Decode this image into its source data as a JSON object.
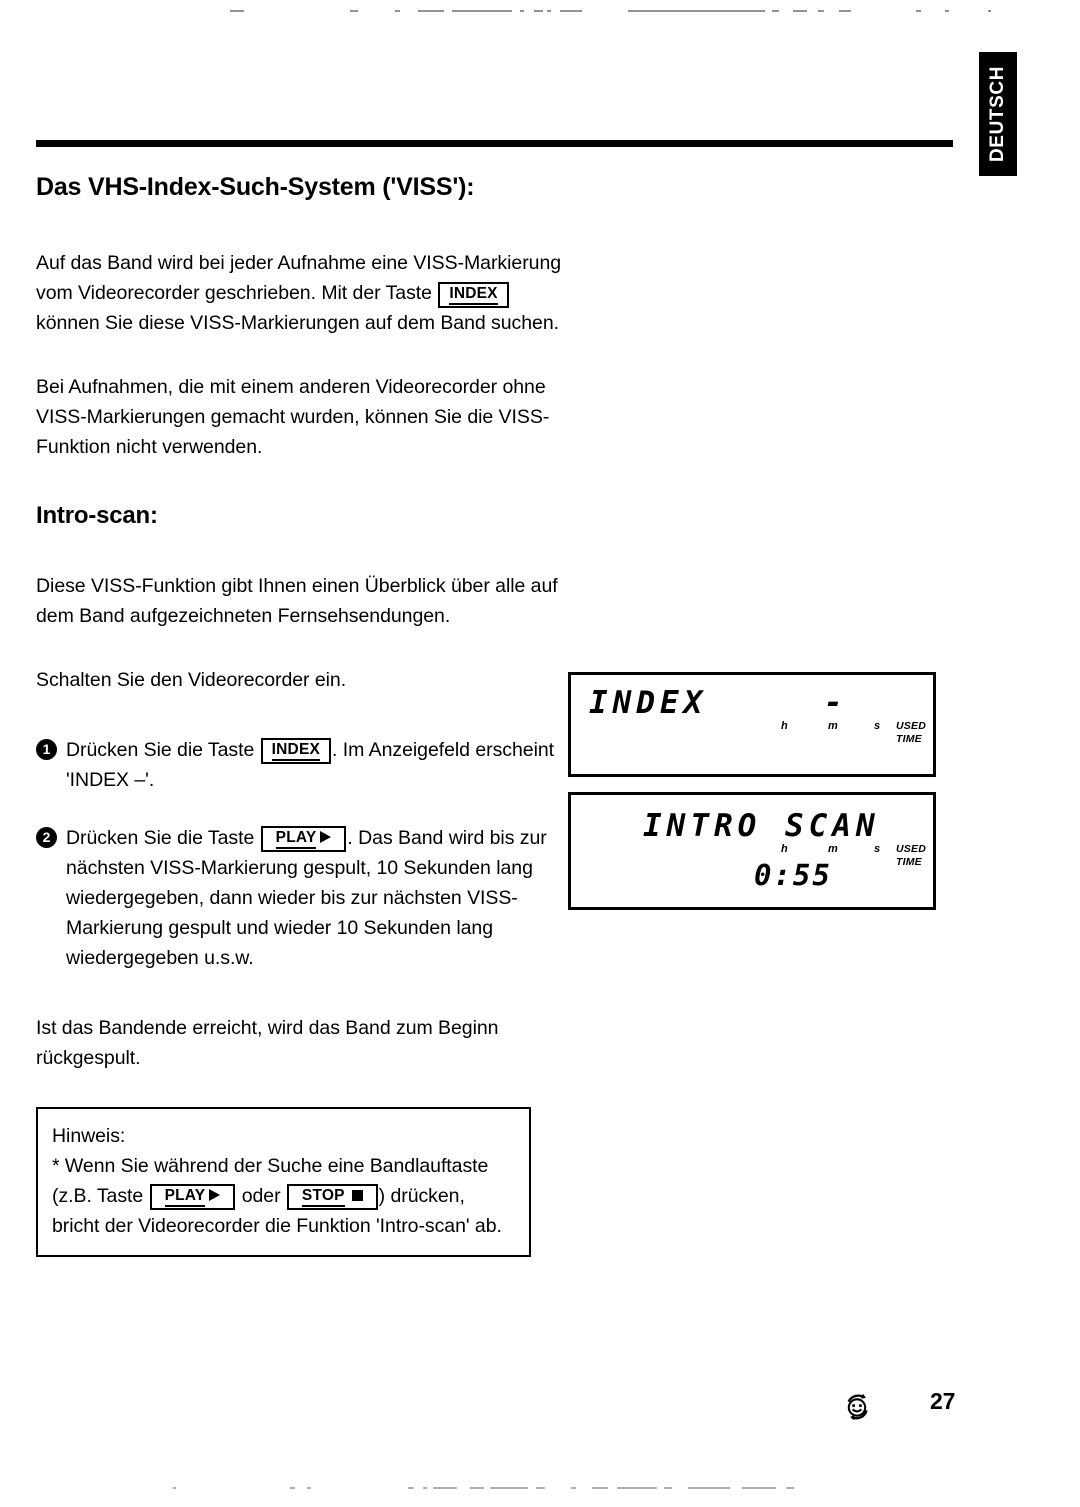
{
  "language_tab": {
    "label": "DEUTSCH"
  },
  "headings": {
    "section_title": "Das VHS-Index-Such-System ('VISS'):",
    "sub_title": "Intro-scan:"
  },
  "paragraphs": {
    "p1_a": "Auf das Band wird bei jeder Aufnahme eine VISS-Markierung vom Videorecorder geschrieben. Mit der Taste",
    "p1_b": "können Sie diese VISS-Markierungen auf dem Band suchen.",
    "p2": "Bei Aufnahmen, die mit einem anderen Videorecorder ohne VISS-Markierungen gemacht wurden, können Sie die VISS-Funktion nicht verwenden.",
    "p3": "Diese VISS-Funktion gibt Ihnen einen Überblick über alle auf dem Band aufgezeichneten Fernsehsendungen.",
    "p4": "Schalten Sie den Videorecorder ein.",
    "p5": "Ist das Bandende erreicht, wird das Band zum Beginn rückgespult."
  },
  "keys": {
    "index": "INDEX",
    "play": "PLAY",
    "stop": "STOP"
  },
  "steps": [
    {
      "number": "1",
      "text_before_key": "Drücken Sie die Taste",
      "text_after_key": ". Im Anzeigefeld erscheint 'INDEX –'."
    },
    {
      "number": "2",
      "text_before_key": "Drücken Sie die Taste",
      "text_after_key": ". Das Band wird bis zur nächsten VISS-Markierung gespult, 10 Sekunden lang wiedergegeben, dann wieder bis zur nächsten VISS-Markierung gespult und wieder 10 Sekunden lang wiedergegeben u.s.w."
    }
  ],
  "note": {
    "title": "Hinweis:",
    "line_start": "* Wenn Sie während der Suche eine Bandlauftaste (z.B. Taste",
    "line_middle": "oder",
    "line_end": ") drücken, bricht der Videorecorder die Funktion 'Intro-scan' ab."
  },
  "displays": [
    {
      "id": "panel-index",
      "main_text": "INDEX",
      "secondary_text": "-",
      "time_value": "",
      "units": {
        "h": "h",
        "m": "m",
        "s": "s",
        "used": "USED",
        "time": "TIME"
      }
    },
    {
      "id": "panel-intro",
      "main_text": "INTRO SCAN",
      "secondary_text": "",
      "time_value": "0:55",
      "units": {
        "h": "h",
        "m": "m",
        "s": "s",
        "used": "USED",
        "time": "TIME"
      }
    }
  ],
  "footer": {
    "icon_name": "recycle-smiley-icon",
    "page_number": "27"
  },
  "colors": {
    "ink": "#000000",
    "paper": "#ffffff"
  }
}
